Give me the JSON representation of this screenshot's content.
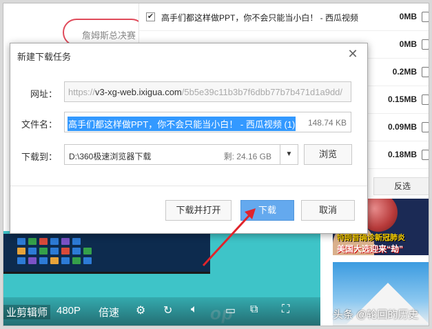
{
  "background_page": {
    "top_left_text": "詹姆斯总决赛"
  },
  "download_list": {
    "rows": [
      {
        "checked": true,
        "name": "高手们都这样做PPT，你不会只能当小白！ - 西瓜视频",
        "size": "0MB"
      },
      {
        "checked": false,
        "name": "",
        "size": "0MB"
      },
      {
        "checked": false,
        "name": "",
        "size": "0.2MB"
      },
      {
        "checked": false,
        "name": "",
        "size": "0.15MB"
      },
      {
        "checked": false,
        "name": "",
        "size": "0.09MB"
      },
      {
        "checked": false,
        "name": "",
        "size": "0.18MB"
      }
    ],
    "invert_label": "反选"
  },
  "video": {
    "watermark": "op",
    "controls": {
      "editor_label": "业剪辑师",
      "quality": "480P",
      "speed": "倍速"
    }
  },
  "thumbnails": {
    "top_line1": "特朗普确诊新冠肺炎",
    "top_line2": "美国大选迎来“劫”",
    "credit": "头条 @轮回的历史"
  },
  "dialog": {
    "title": "新建下载任务",
    "url_label": "网址：",
    "url_prefix": "https://",
    "url_host": "v3-xg-web.ixigua.com",
    "url_rest": "/5b5e39c11b3b7f6dbb77b7b471d1a9dd/",
    "filename_label": "文件名：",
    "filename": "高手们都这样做PPT，你不会只能当小白！ - 西瓜视频 (1)",
    "filesize": "148.74 KB",
    "saveto_label": "下载到：",
    "save_path": "D:\\360极速浏览器下载",
    "free_space": "剩: 24.16 GB",
    "browse_label": "浏览",
    "open_label": "下载并打开",
    "download_label": "下载",
    "cancel_label": "取消"
  },
  "colors": {
    "accent": "#64a9ee",
    "selection": "#3399ff",
    "arrow": "#e0242b",
    "video_bg": "#3ec4c8"
  }
}
